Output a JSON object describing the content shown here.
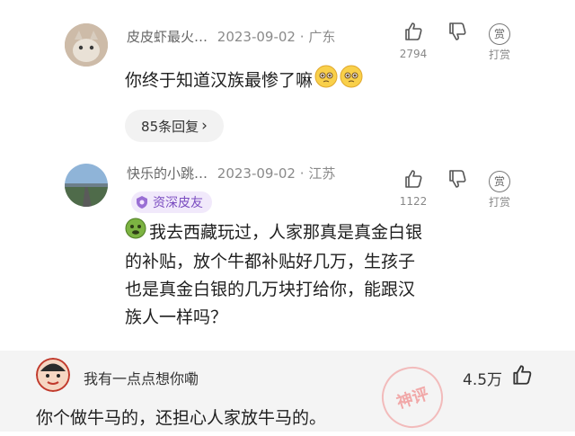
{
  "comments": [
    {
      "username": "皮皮虾最火…",
      "date": "2023-09-02",
      "location": "广东",
      "text": "你终于知道汉族最惨了嘛",
      "likes": "2794",
      "reward_label": "打赏",
      "reward_icon_text": "赏",
      "replies_label": "85条回复",
      "replies_chevron": "›",
      "emoji": "pleading-face"
    },
    {
      "username": "快乐的小跳…",
      "date": "2023-09-02",
      "location": "江苏",
      "badge": "资深皮友",
      "text_line1": "我去西藏玩过，人家那真是真金白银",
      "text_line2": "的补贴，放个牛都补贴好几万，生孩子",
      "text_line3": "也是真金白银的几万块打给你，能跟汉",
      "text_line4": "族人一样吗？",
      "likes": "1122",
      "reward_label": "打赏",
      "reward_icon_text": "赏",
      "emoji": "green-face"
    }
  ],
  "hot_comment": {
    "username": "我有一点点想你嘞",
    "likes": "4.5万",
    "text": "你个做牛马的，还担心人家放牛马的。",
    "stamp": "神评"
  },
  "colors": {
    "accent_purple": "#7a4cc0",
    "muted_gray": "#8a8a8a",
    "stamp_red": "#f08f8f"
  }
}
